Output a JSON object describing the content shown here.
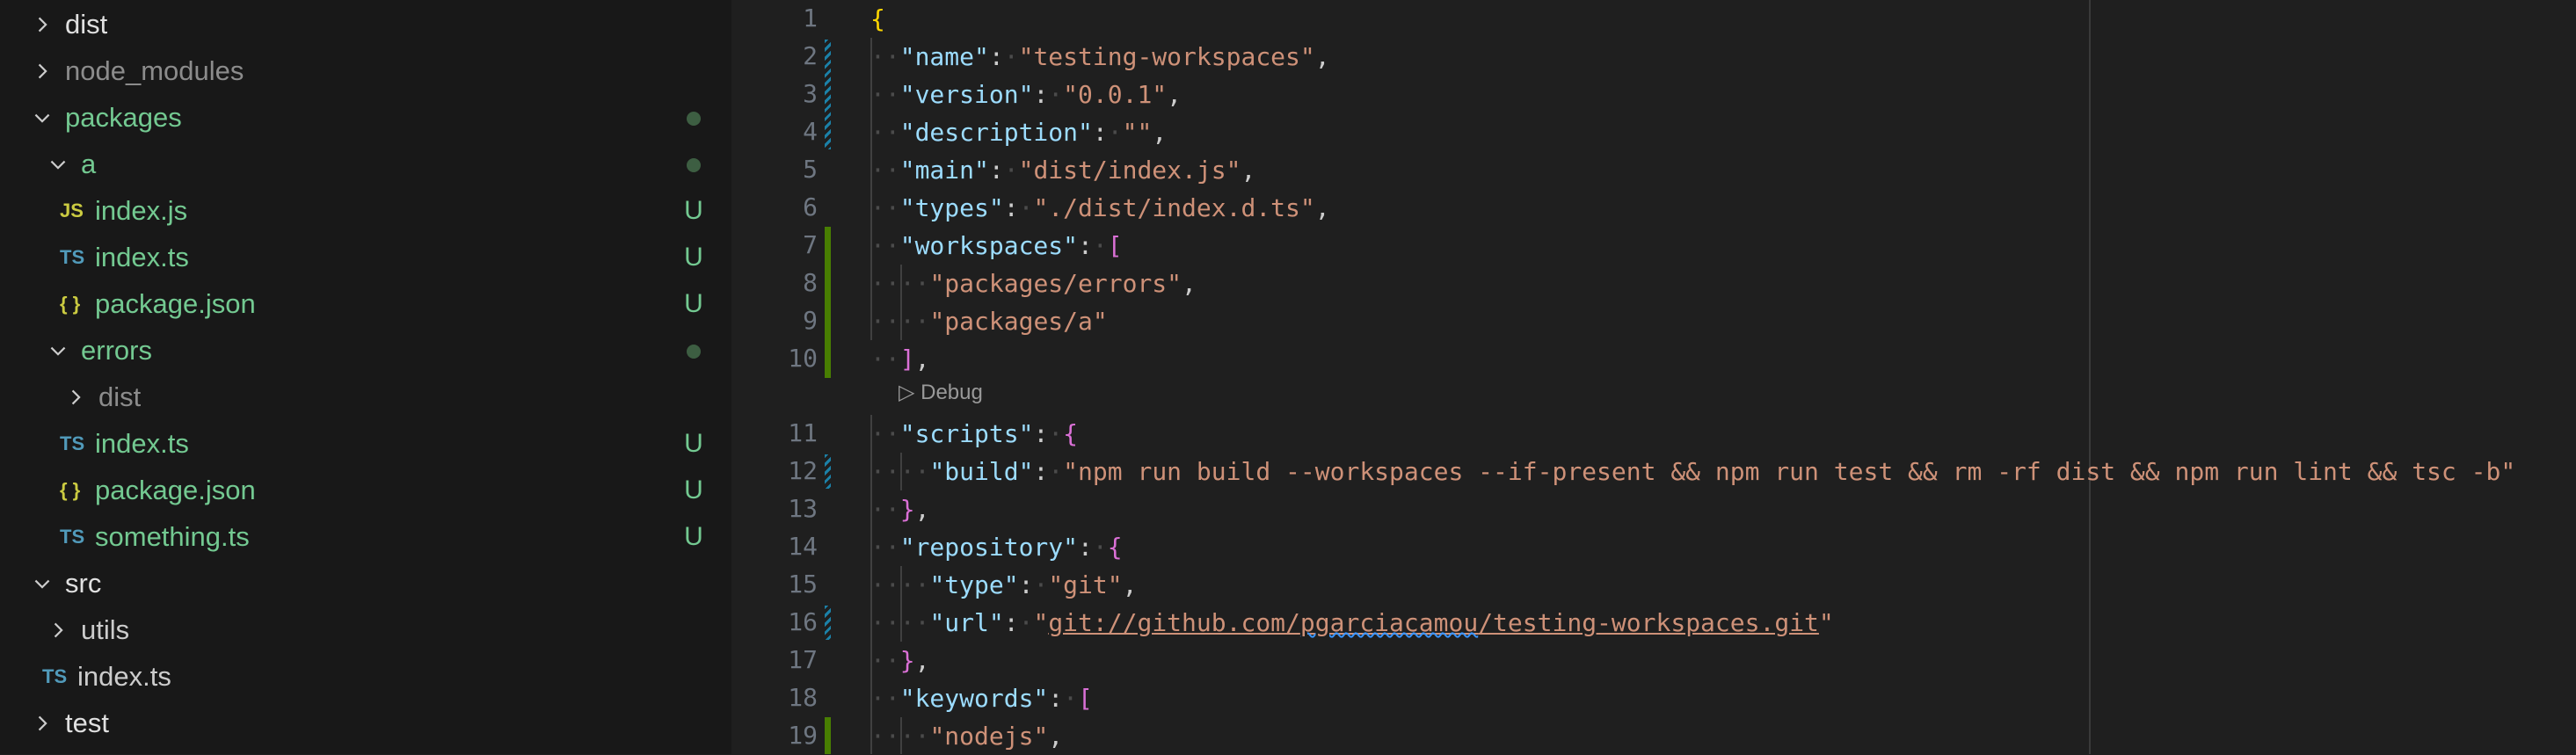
{
  "colors": {
    "git_untracked": "#73c991",
    "folder_text": "#cccccc",
    "ignored_text": "#8c8c8c",
    "js_icon": "#cbcb41",
    "ts_icon": "#519aba",
    "json_icon": "#cbcb41"
  },
  "explorer": {
    "items": [
      {
        "label": "dist",
        "expanded": false,
        "kind": "folder",
        "status": ""
      },
      {
        "label": "node_modules",
        "expanded": false,
        "kind": "folder",
        "status": ""
      },
      {
        "label": "packages",
        "expanded": true,
        "kind": "folder",
        "status": "dot"
      },
      {
        "label": "a",
        "expanded": true,
        "kind": "folder",
        "status": "dot"
      },
      {
        "label": "index.js",
        "kind": "file",
        "icon": "JS",
        "status": "U"
      },
      {
        "label": "index.ts",
        "kind": "file",
        "icon": "TS",
        "status": "U"
      },
      {
        "label": "package.json",
        "kind": "file",
        "icon": "{ }",
        "status": "U"
      },
      {
        "label": "errors",
        "expanded": true,
        "kind": "folder",
        "status": "dot"
      },
      {
        "label": "dist",
        "expanded": false,
        "kind": "folder",
        "status": ""
      },
      {
        "label": "index.ts",
        "kind": "file",
        "icon": "TS",
        "status": "U"
      },
      {
        "label": "package.json",
        "kind": "file",
        "icon": "{ }",
        "status": "U"
      },
      {
        "label": "something.ts",
        "kind": "file",
        "icon": "TS",
        "status": "U"
      },
      {
        "label": "src",
        "expanded": true,
        "kind": "folder",
        "status": ""
      },
      {
        "label": "utils",
        "expanded": false,
        "kind": "folder",
        "status": ""
      },
      {
        "label": "index.ts",
        "kind": "file",
        "icon": "TS",
        "status": ""
      },
      {
        "label": "test",
        "expanded": false,
        "kind": "folder",
        "status": ""
      }
    ]
  },
  "editor": {
    "codelens": "▷ Debug",
    "lines": [
      {
        "n": "1",
        "text": "{"
      },
      {
        "n": "2",
        "text": "  \"name\": \"testing-workspaces\","
      },
      {
        "n": "3",
        "text": "  \"version\": \"0.0.1\","
      },
      {
        "n": "4",
        "text": "  \"description\": \"\","
      },
      {
        "n": "5",
        "text": "  \"main\": \"dist/index.js\","
      },
      {
        "n": "6",
        "text": "  \"types\": \"./dist/index.d.ts\","
      },
      {
        "n": "7",
        "text": "  \"workspaces\": ["
      },
      {
        "n": "8",
        "text": "    \"packages/errors\","
      },
      {
        "n": "9",
        "text": "    \"packages/a\""
      },
      {
        "n": "10",
        "text": "  ],"
      },
      {
        "n": "11",
        "text": "  \"scripts\": {"
      },
      {
        "n": "12",
        "text": "    \"build\": \"npm run build --workspaces --if-present && npm run test && rm -rf dist && npm run lint && tsc -b\""
      },
      {
        "n": "13",
        "text": "  },"
      },
      {
        "n": "14",
        "text": "  \"repository\": {"
      },
      {
        "n": "15",
        "text": "    \"type\": \"git\","
      },
      {
        "n": "16",
        "text": "    \"url\": \"git://github.com/pgarciacamou/testing-workspaces.git\""
      },
      {
        "n": "17",
        "text": "  },"
      },
      {
        "n": "18",
        "text": "  \"keywords\": ["
      },
      {
        "n": "19",
        "text": "    \"nodejs\","
      }
    ]
  }
}
